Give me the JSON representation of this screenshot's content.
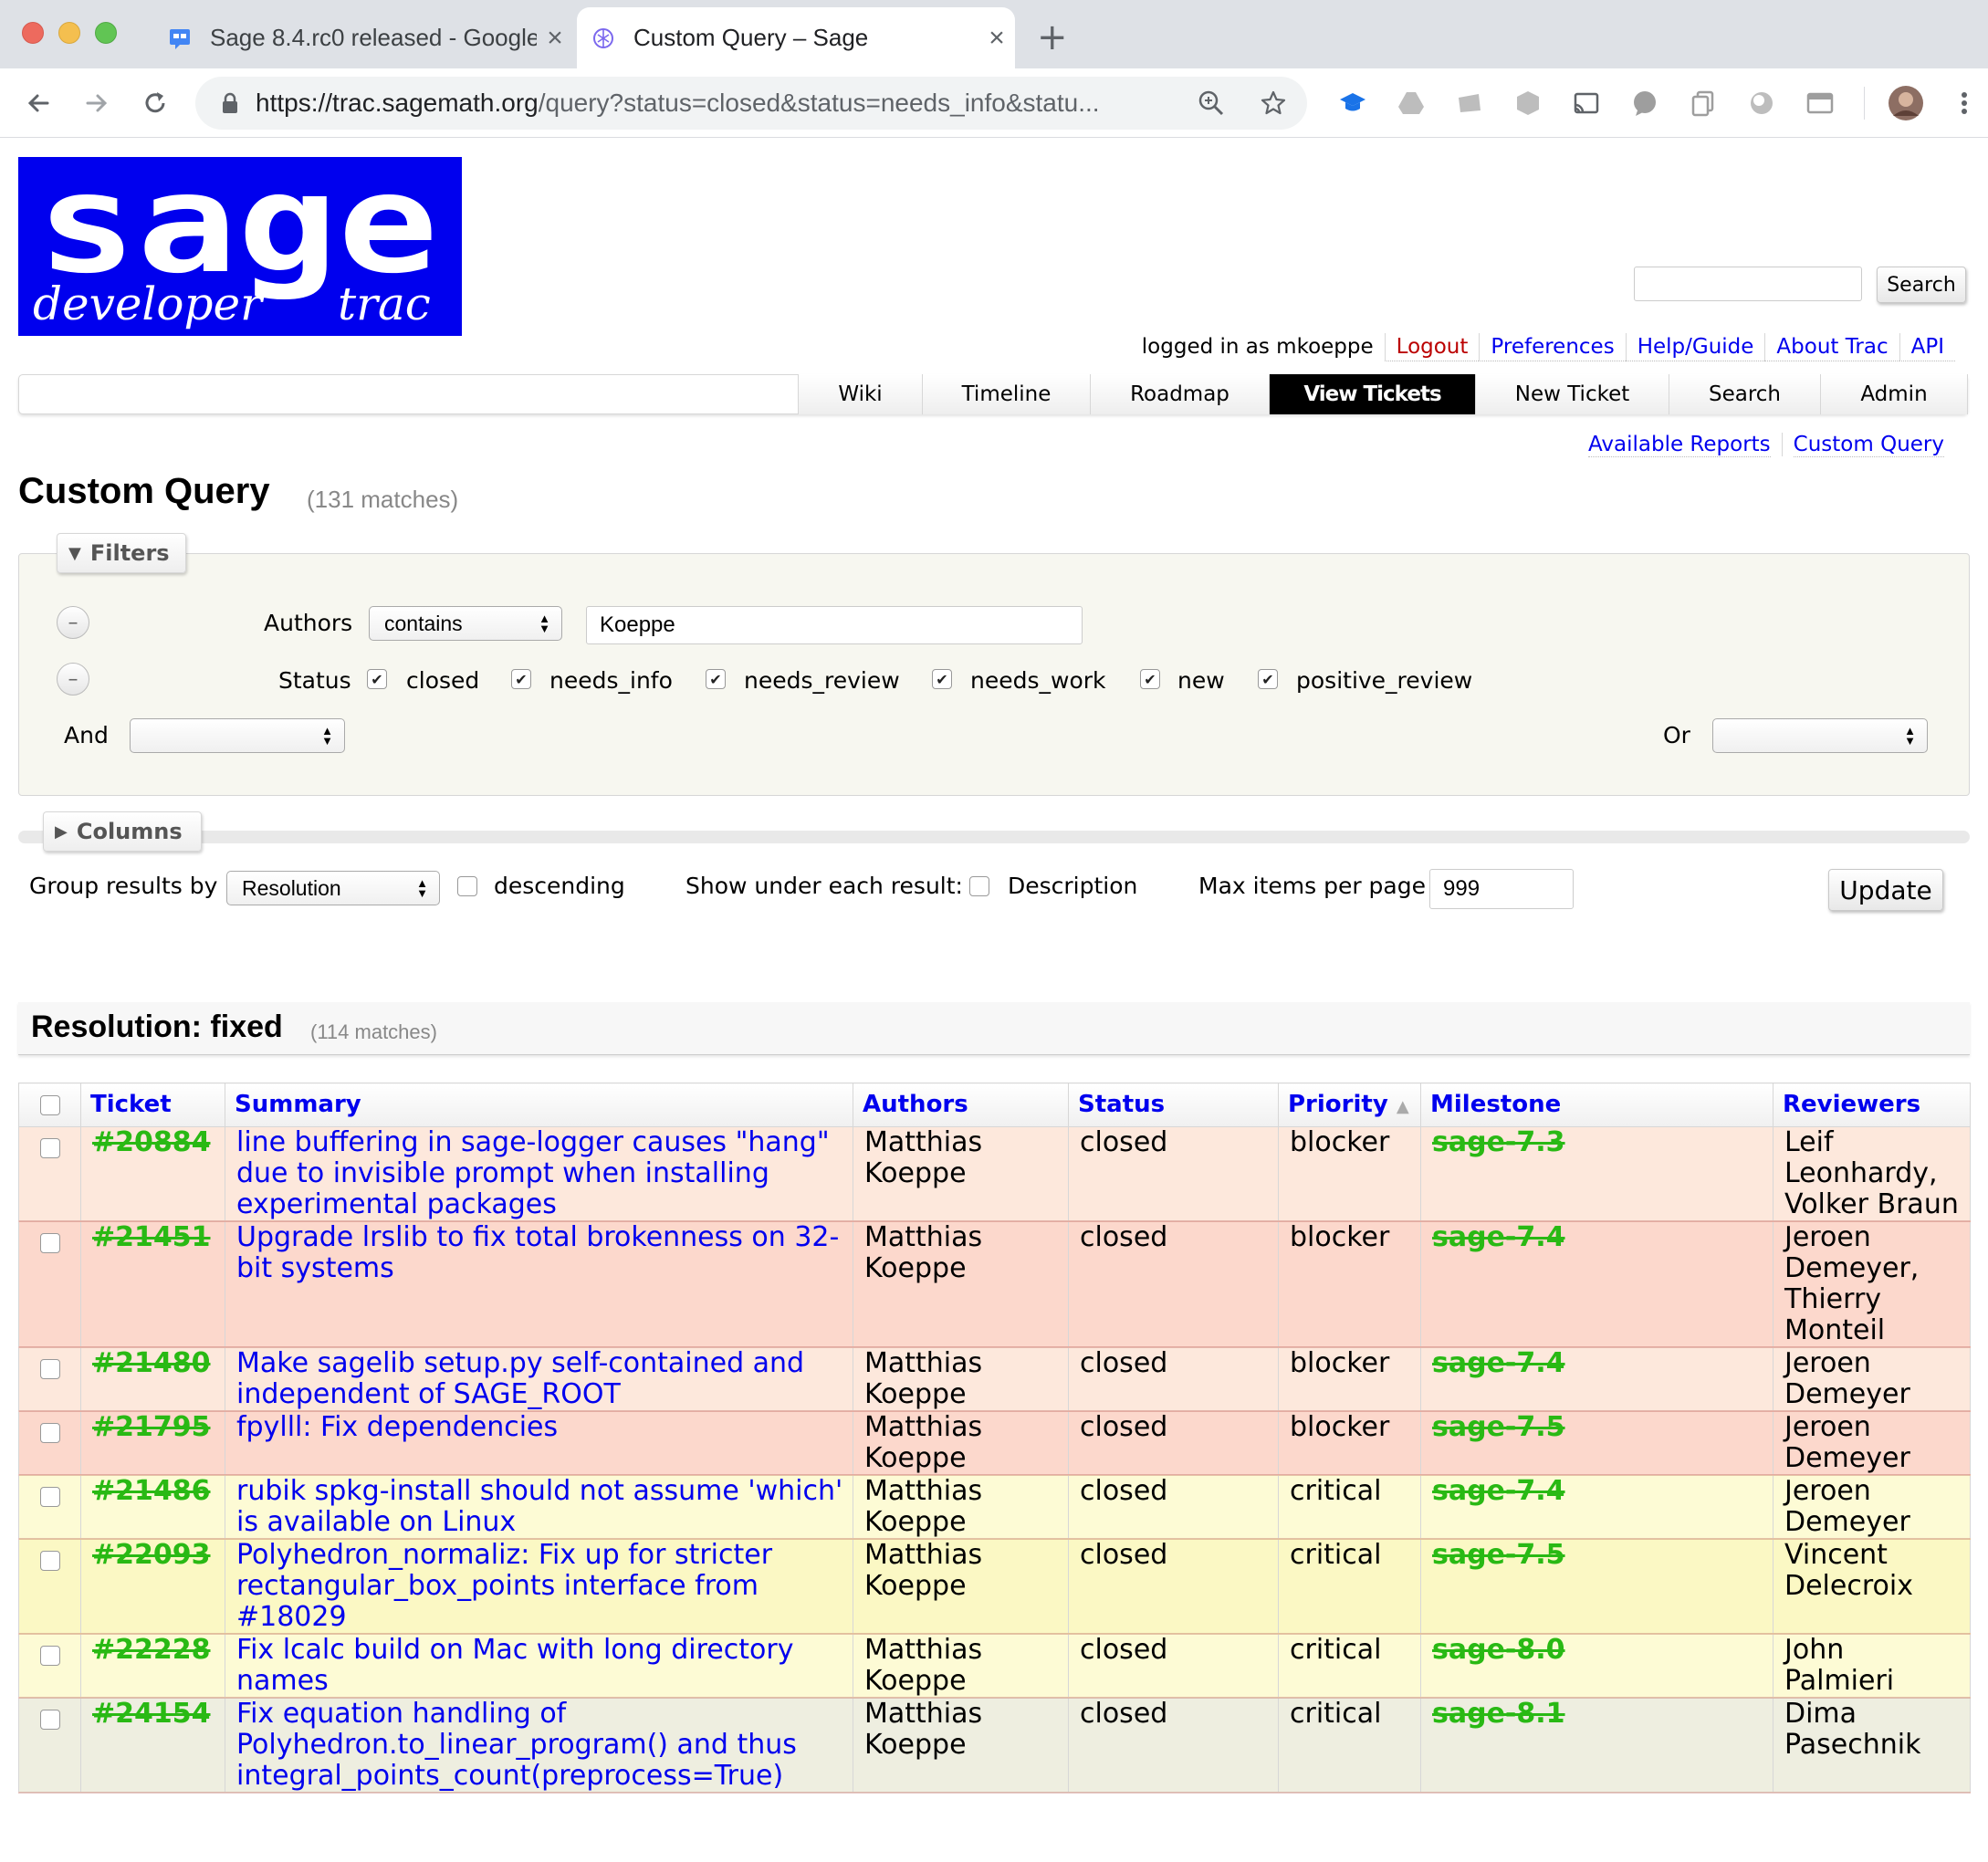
{
  "browser": {
    "tabs": [
      {
        "title": "Sage 8.4.rc0 released - Google",
        "active": false
      },
      {
        "title": "Custom Query – Sage",
        "active": true
      }
    ],
    "url_host": "https://trac.sagemath.org",
    "url_rest": "/query?status=closed&status=needs_info&statu..."
  },
  "site": {
    "logo_main": "sage",
    "logo_left": "developer",
    "logo_right": "trac",
    "search_button": "Search",
    "search_placeholder": ""
  },
  "metanav": {
    "logged_in": "logged in as mkoeppe",
    "logout": "Logout",
    "preferences": "Preferences",
    "help": "Help/Guide",
    "about": "About Trac",
    "api": "API"
  },
  "mainnav": [
    {
      "label": "Wiki",
      "active": false
    },
    {
      "label": "Timeline",
      "active": false
    },
    {
      "label": "Roadmap",
      "active": false
    },
    {
      "label": "View Tickets",
      "active": true
    },
    {
      "label": "New Ticket",
      "active": false
    },
    {
      "label": "Search",
      "active": false
    },
    {
      "label": "Admin",
      "active": false
    }
  ],
  "ctxtnav": {
    "available_reports": "Available Reports",
    "custom_query": "Custom Query"
  },
  "page": {
    "title": "Custom Query",
    "matches": "(131 matches)"
  },
  "filters": {
    "legend": "Filters",
    "authors_label": "Authors",
    "authors_op": "contains",
    "authors_value": "Koeppe",
    "status_label": "Status",
    "statuses": [
      {
        "label": "closed",
        "checked": true
      },
      {
        "label": "needs_info",
        "checked": true
      },
      {
        "label": "needs_review",
        "checked": true
      },
      {
        "label": "needs_work",
        "checked": true
      },
      {
        "label": "new",
        "checked": true
      },
      {
        "label": "positive_review",
        "checked": true
      }
    ],
    "and_label": "And",
    "or_label": "Or",
    "and_value": "",
    "or_value": ""
  },
  "columns": {
    "legend": "Columns"
  },
  "options": {
    "group_by_label": "Group results by",
    "group_by_value": "Resolution",
    "descending_label": "descending",
    "show_under_label": "Show under each result:",
    "description_label": "Description",
    "max_items_label": "Max items per page",
    "max_items_value": "999",
    "update_button": "Update"
  },
  "group": {
    "title": "Resolution: fixed",
    "matches": "(114 matches)"
  },
  "table": {
    "headers": {
      "ticket": "Ticket",
      "summary": "Summary",
      "authors": "Authors",
      "status": "Status",
      "priority": "Priority",
      "milestone": "Milestone",
      "reviewers": "Reviewers"
    },
    "rows": [
      {
        "ticket": "#20884",
        "summary": "line buffering in sage-logger causes \"hang\" due to invisible prompt when installing experimental packages",
        "authors": "Matthias Koeppe",
        "status": "closed",
        "priority": "blocker",
        "milestone": "sage-7.3",
        "reviewers": "Leif Leonhardy, Volker Braun"
      },
      {
        "ticket": "#21451",
        "summary": "Upgrade lrslib to fix total brokenness on 32-bit systems",
        "authors": "Matthias Koeppe",
        "status": "closed",
        "priority": "blocker",
        "milestone": "sage-7.4",
        "reviewers": "Jeroen Demeyer, Thierry Monteil"
      },
      {
        "ticket": "#21480",
        "summary": "Make sagelib setup.py self-contained and independent of SAGE_ROOT",
        "authors": "Matthias Koeppe",
        "status": "closed",
        "priority": "blocker",
        "milestone": "sage-7.4",
        "reviewers": "Jeroen Demeyer"
      },
      {
        "ticket": "#21795",
        "summary": "fpylll: Fix dependencies",
        "authors": "Matthias Koeppe",
        "status": "closed",
        "priority": "blocker",
        "milestone": "sage-7.5",
        "reviewers": "Jeroen Demeyer"
      },
      {
        "ticket": "#21486",
        "summary": "rubik spkg-install should not assume 'which' is available on Linux",
        "authors": "Matthias Koeppe",
        "status": "closed",
        "priority": "critical",
        "milestone": "sage-7.4",
        "reviewers": "Jeroen Demeyer"
      },
      {
        "ticket": "#22093",
        "summary": "Polyhedron_normaliz: Fix up for stricter rectangular_box_points interface from #18029",
        "authors": "Matthias Koeppe",
        "status": "closed",
        "priority": "critical",
        "milestone": "sage-7.5",
        "reviewers": "Vincent Delecroix"
      },
      {
        "ticket": "#22228",
        "summary": "Fix lcalc build on Mac with long directory names",
        "authors": "Matthias Koeppe",
        "status": "closed",
        "priority": "critical",
        "milestone": "sage-8.0",
        "reviewers": "John Palmieri"
      },
      {
        "ticket": "#24154",
        "summary": "Fix equation handling of Polyhedron.to_linear_program() and thus integral_points_count(preprocess=True)",
        "authors": "Matthias Koeppe",
        "status": "closed",
        "priority": "critical",
        "milestone": "sage-8.1",
        "reviewers": "Dima Pasechnik"
      }
    ]
  },
  "colors": {
    "link": "#0000ee",
    "closed_green": "#29b914",
    "logo_bg": "#0000ee"
  }
}
